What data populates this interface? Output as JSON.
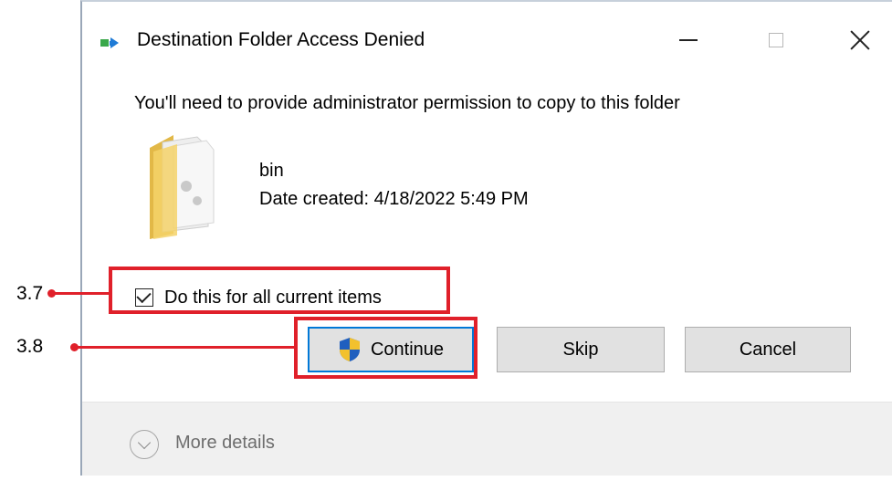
{
  "dialog": {
    "title": "Destination Folder Access Denied",
    "message": "You'll need to provide administrator permission to copy to this folder",
    "file": {
      "name": "bin",
      "date_created": "Date created: 4/18/2022 5:49 PM",
      "icon": "folder-icon"
    },
    "checkbox": {
      "label": "Do this for all current items",
      "checked": true
    },
    "buttons": {
      "continue_label": "Continue",
      "skip_label": "Skip",
      "cancel_label": "Cancel"
    },
    "more_details_label": "More details"
  },
  "window_controls": [
    "minimize-icon",
    "maximize-icon",
    "close-icon"
  ],
  "annotations": {
    "checkbox_step": "3.7",
    "continue_step": "3.8",
    "highlight_color": "#e0202a"
  },
  "colors": {
    "focus_border": "#0078d7",
    "button_face": "#e1e1e1",
    "footer_bg": "#f0f0f0"
  }
}
